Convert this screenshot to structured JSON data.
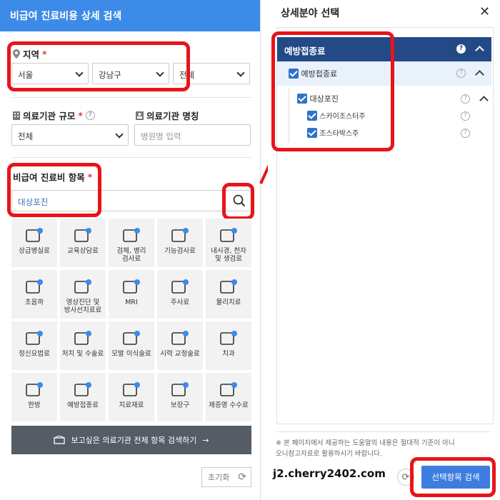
{
  "left": {
    "title": "비급여 진료비용 상세 검색",
    "region": {
      "label": "지역",
      "req": "*",
      "city": "서울",
      "district": "강남구",
      "dong": "전체"
    },
    "scale": {
      "label": "의료기관 규모",
      "req": "*",
      "value": "전체"
    },
    "name": {
      "label": "의료기관 명칭",
      "placeholder": "병원명 입력"
    },
    "items": {
      "label": "비급여 진료비 항목",
      "req": "*",
      "value": "대상포진"
    },
    "grid": [
      "상급병실료",
      "교육상담료",
      "검체, 병리\n검사료",
      "기능검사료",
      "내시경, 천자\n및 생검료",
      "초음파",
      "영상진단 및\n방사선치료료",
      "MRI",
      "주사료",
      "물리치료",
      "정신요법료",
      "처치 및 수술료",
      "모발 이식술료",
      "시력 교정술료",
      "치과",
      "한방",
      "예방접종료",
      "치료재료",
      "보장구",
      "제증명 수수료"
    ],
    "search_all": "보고싶은 의료기관 전체 항목 검색하기",
    "reset": "초기화"
  },
  "right": {
    "title": "상세분야 선택",
    "close": "✕",
    "head": "예방접종료",
    "l1": "예방접종료",
    "l2": "대상포진",
    "l3a": "스카이조스터주",
    "l3b": "조스타박스주",
    "notice1": "※ 본 페이지에서 제공하는 도움말의 내용은 절대적 기준이 아니",
    "notice2": "오니참고자료로 활용하시기 바랍니다.",
    "watermark": "j2.cherry2402.com",
    "search_btn": "선택항목 검색"
  }
}
